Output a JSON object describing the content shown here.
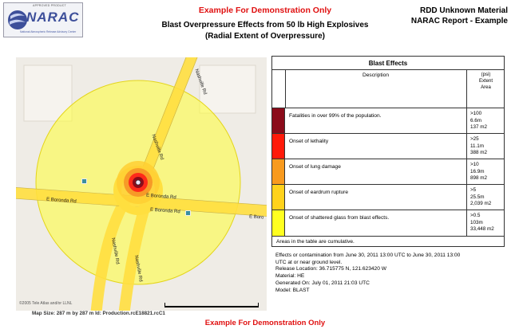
{
  "header": {
    "logo": {
      "badge": "APPROVED PRODUCT",
      "brand": "NARAC",
      "tagline": "National Atmospheric Release Advisory Center",
      "icon": "narac-logo-icon"
    },
    "demo_notice": "Example For Demonstration Only",
    "title_line1": "Blast Overpressure Effects from 50 lb High Explosives",
    "title_line2": "(Radial Extent of Overpressure)",
    "right_line1": "RDD Unknown Material",
    "right_line2": "NARAC Report - Example"
  },
  "map": {
    "road_labels": {
      "nashville_top": "Nashville Rd",
      "nashville_mid": "Nashville Rd",
      "nashville_low1": "Nashville Rd",
      "nashville_low2": "Nashville Rd",
      "boronda_center": "E Boronda Rd",
      "boronda_right": "E Boronda Rd",
      "boronda_left": "E Boronda Rd",
      "boronda_far_right": "E Boro"
    },
    "copyright": "©2005 Tele Atlas and/or LLNL",
    "scale_text": "150 m",
    "footer": "Map Size: 287 m by 287 m  Id: Production.rcE18821.rcC1",
    "colors": {
      "ring_outer": "#ffff33",
      "ring_glass": "#ffec3c",
      "ring_eardrum": "#ffcf32",
      "ring_lung": "#f79a27",
      "ring_lethal": "#ff2a1a",
      "ring_fatal": "#8b0b1a",
      "road": "#ffdf3f",
      "land": "#efece6"
    }
  },
  "table": {
    "title": "Blast Effects",
    "header_description": "Description",
    "header_unit": "(psi)",
    "header_extent": "Extent",
    "header_area": "Area",
    "rows": [
      {
        "color": "#8b0b1a",
        "description": "Fatalities in over 99% of the population.",
        "psi": ">100",
        "extent": "6.6m",
        "area": "137 m2"
      },
      {
        "color": "#ff1a0a",
        "description": "Onset of lethality",
        "psi": ">25",
        "extent": "11.1m",
        "area": "388 m2"
      },
      {
        "color": "#f89a1e",
        "description": "Onset of lung damage",
        "psi": ">10",
        "extent": "16.9m",
        "area": "898 m2"
      },
      {
        "color": "#ffd21c",
        "description": "Onset of eardrum rupture",
        "psi": ">5",
        "extent": "25.5m",
        "area": "2,039 m2"
      },
      {
        "color": "#ffff20",
        "description": "Onset of shattered glass from blast effects.",
        "psi": ">0.5",
        "extent": "103m",
        "area": "33,448 m2"
      }
    ],
    "note": "Areas in the table are cumulative."
  },
  "info": {
    "line1": "Effects or contamination from June 30, 2011 13:00 UTC to June 30, 2011 13:00",
    "line2": "UTC at or near ground level.",
    "line3": "Release Location: 36.715775 N, 121.623420 W",
    "line4": "Material: HE",
    "line5": "Generated On: July 01, 2011 21:03 UTC",
    "line6": "Model: BLAST"
  },
  "footer": {
    "demo_notice": "Example For Demonstration Only"
  }
}
